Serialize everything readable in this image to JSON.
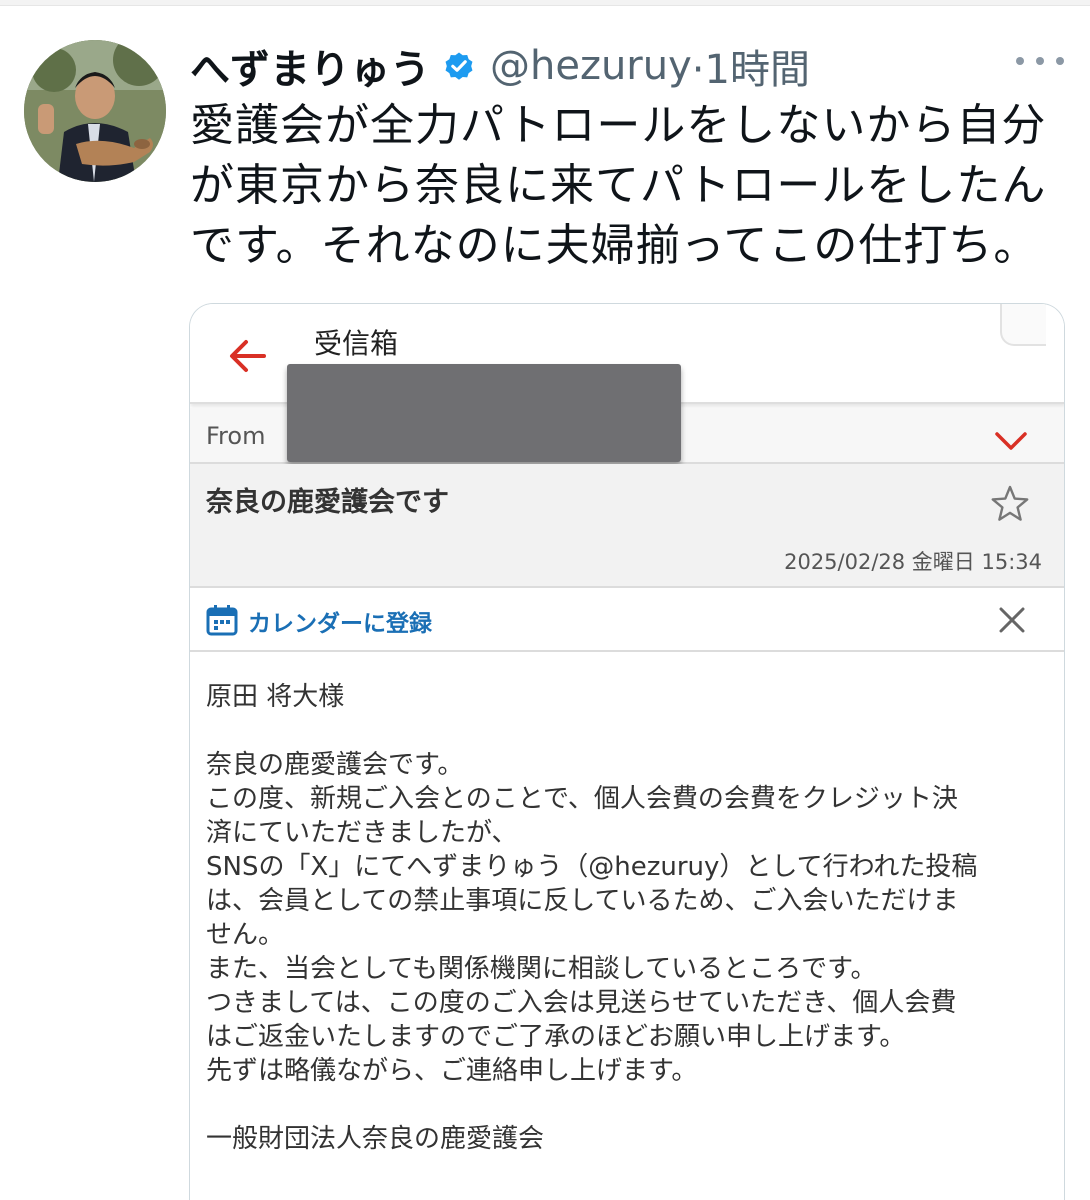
{
  "tweet": {
    "display_name": "へずまりゅう",
    "handle": "@hezuruy",
    "separator_time": "·1時間",
    "text_lines": [
      "愛護会が全力パトロールをしないから自分",
      "が東京から奈良に来てパトロールをしたん",
      "です。それなのに夫婦揃ってこの仕打ち。"
    ]
  },
  "email": {
    "header_title": "受信箱",
    "from_label": "From",
    "subject": "奈良の鹿愛護会です",
    "date": "2025/02/28 金曜日 15:34",
    "calendar_label": "カレンダーに登録",
    "body": {
      "greeting": "原田 将大様",
      "lines": [
        "奈良の鹿愛護会です。",
        "この度、新規ご入会とのことで、個人会費の会費をクレジット決",
        "済にていただきましたが、",
        "SNSの「X」にてへずまりゅう（@hezuruy）として行われた投稿",
        "は、会員としての禁止事項に反しているため、ご入会いただけま",
        "せん。",
        "また、当会としても関係機関に相談しているところです。",
        "つきましては、この度のご入会は見送らせていただき、個人会費",
        "はご返金いたしますのでご了承のほどお願い申し上げます。",
        "先ずは略儀ながら、ご連絡申し上げます。"
      ],
      "signature": "一般財団法人奈良の鹿愛護会"
    }
  },
  "colors": {
    "verified": "#1d9bf0",
    "accent_red": "#d93025",
    "calendar_blue": "#1a6fb5",
    "muted_text": "#536471"
  },
  "icons": [
    "verified-badge-icon",
    "more-icon",
    "back-arrow-icon",
    "chevron-down-icon",
    "star-icon",
    "calendar-icon",
    "close-icon"
  ]
}
